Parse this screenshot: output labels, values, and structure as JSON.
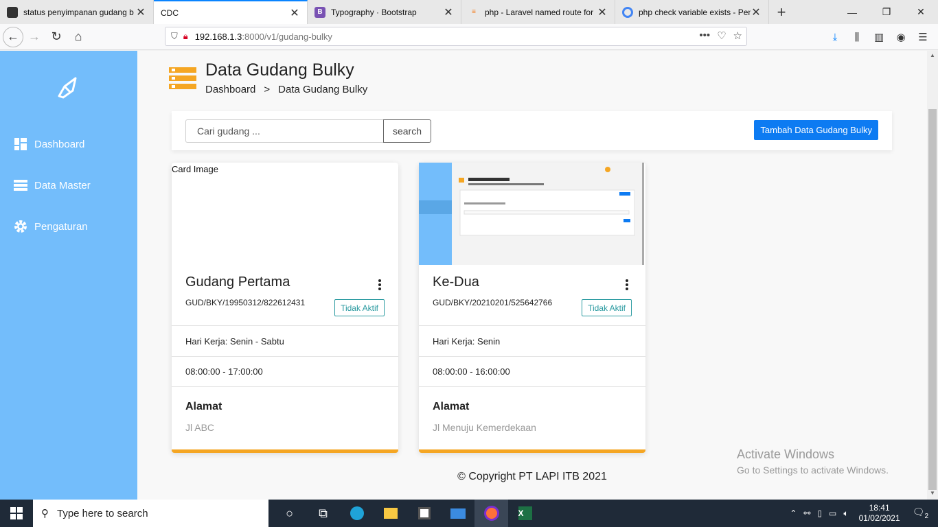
{
  "browser": {
    "tabs": [
      {
        "title": "status penyimpanan gudang b",
        "favicon": "dark-icon",
        "active": false
      },
      {
        "title": "CDC",
        "favicon": "",
        "active": true
      },
      {
        "title": "Typography · Bootstrap",
        "favicon": "bootstrap-icon",
        "active": false
      },
      {
        "title": "php - Laravel named route for",
        "favicon": "stackoverflow-icon",
        "active": false
      },
      {
        "title": "php check variable exists - Pen",
        "favicon": "google-icon",
        "active": false
      }
    ],
    "url_host": "192.168.1.3",
    "url_rest": ":8000/v1/gudang-bulky"
  },
  "sidebar": {
    "items": [
      {
        "label": "Dashboard",
        "icon": "dashboard-icon"
      },
      {
        "label": "Data Master",
        "icon": "list-icon"
      },
      {
        "label": "Pengaturan",
        "icon": "gear-icon"
      }
    ]
  },
  "page": {
    "title": "Data Gudang Bulky",
    "breadcrumb": [
      "Dashboard",
      ">",
      "Data Gudang Bulky"
    ],
    "search_placeholder": "Cari gudang ...",
    "search_label": "search",
    "add_label": "Tambah Data Gudang Bulky"
  },
  "cards": [
    {
      "image_alt": "Card Image",
      "name": "Gudang Pertama",
      "code": "GUD/BKY/19950312/822612431",
      "status": "Tidak Aktif",
      "workdays": "Hari Kerja: Senin - Sabtu",
      "hours": "08:00:00 - 17:00:00",
      "address_label": "Alamat",
      "address": "Jl ABC"
    },
    {
      "image_alt": "",
      "name": "Ke-Dua",
      "code": "GUD/BKY/20210201/525642766",
      "status": "Tidak Aktif",
      "workdays": "Hari Kerja: Senin",
      "hours": "08:00:00 - 16:00:00",
      "address_label": "Alamat",
      "address": "Jl Menuju Kemerdekaan"
    }
  ],
  "footer": "© Copyright PT LAPI ITB 2021",
  "activate": {
    "line1": "Activate Windows",
    "line2": "Go to Settings to activate Windows."
  },
  "taskbar": {
    "search_placeholder": "Type here to search",
    "time": "18:41",
    "date": "01/02/2021",
    "notifications": "2"
  },
  "colors": {
    "sidebar": "#73bdfb",
    "accent": "#f5a623",
    "primary": "#0d7bf2",
    "status": "#2a9aa0"
  }
}
